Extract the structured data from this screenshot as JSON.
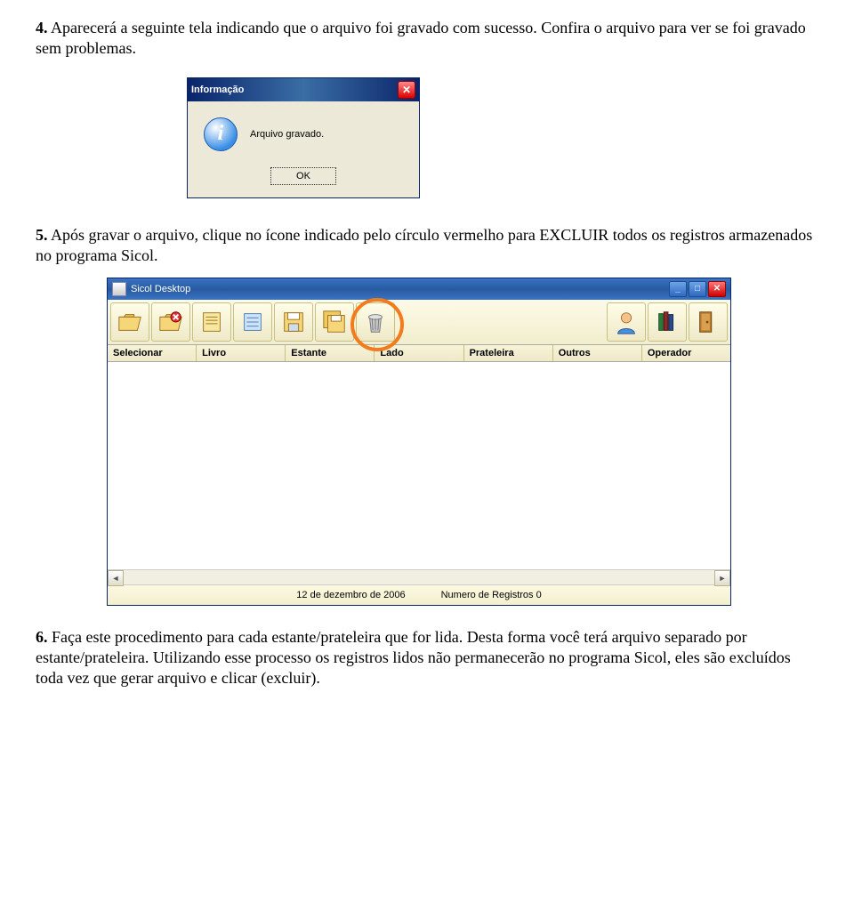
{
  "para4": {
    "num": "4.",
    "text": " Aparecerá a seguinte tela indicando que o arquivo foi gravado com sucesso. Confira o arquivo para ver se foi gravado sem problemas."
  },
  "dialog": {
    "title": "Informação",
    "message": "Arquivo gravado.",
    "ok": "OK"
  },
  "para5": {
    "num": "5.",
    "text": " Após gravar o arquivo, clique no ícone indicado pelo círculo vermelho para EXCLUIR todos os registros armazenados no programa Sicol."
  },
  "sicol": {
    "title": "Sicol Desktop",
    "labels": [
      "Selecionar",
      "Livro",
      "Estante",
      "Lado",
      "Prateleira",
      "Outros",
      "Operador"
    ],
    "status_date": "12 de dezembro de 2006",
    "status_count": "Numero de Registros 0"
  },
  "para6": {
    "num": "6.",
    "text": " Faça este procedimento para cada estante/prateleira que for lida. Desta forma você terá arquivo separado por estante/prateleira. Utilizando esse processo os registros lidos não permanecerão no programa Sicol, eles são excluídos toda vez que gerar arquivo e clicar (excluir)."
  }
}
